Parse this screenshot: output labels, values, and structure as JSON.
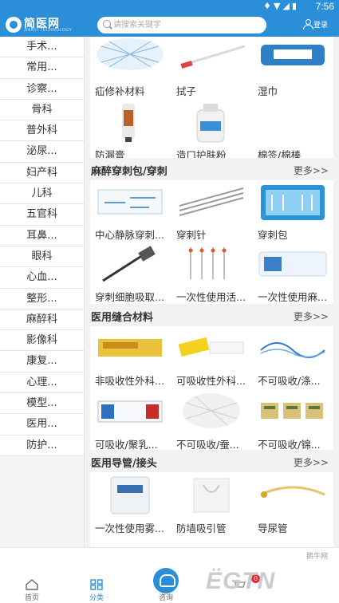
{
  "status": {
    "time": "7:56"
  },
  "header": {
    "logo_name": "简医网",
    "logo_sub": "JIANYI TECHNOLOGY",
    "search_placeholder": "请搜索关键字",
    "login_label": "登录"
  },
  "sidebar": {
    "items": [
      "手术...",
      "常用...",
      "诊察...",
      "骨科",
      "普外科",
      "泌尿...",
      "妇产科",
      "儿科",
      "五官科",
      "耳鼻...",
      "眼科",
      "心血...",
      "整形...",
      "麻醉科",
      "影像科",
      "康复...",
      "心理...",
      "模型...",
      "医用...",
      "防护..."
    ]
  },
  "sections": [
    {
      "title": "",
      "more": "",
      "products": [
        "疝修补材料",
        "拭子",
        "湿巾",
        "防漏膏",
        "造口护肤粉",
        "棉签/棉棒"
      ]
    },
    {
      "title": "麻醉穿刺包/穿刺",
      "more": "更多>>",
      "products": [
        "中心静脉穿刺...",
        "穿刺针",
        "穿刺包",
        "穿刺细胞吸取...",
        "一次性使用活...",
        "一次性使用麻..."
      ]
    },
    {
      "title": "医用缝合材料",
      "more": "更多>>",
      "products": [
        "非吸收性外科...",
        "可吸收性外科...",
        "不可吸收/涤...",
        "可吸收/聚乳...",
        "不可吸收/蚕...",
        "不可吸收/锦..."
      ]
    },
    {
      "title": "医用导管/接头",
      "more": "更多>>",
      "products": [
        "一次性使用雾...",
        "防墙吸引管",
        "导尿管"
      ]
    }
  ],
  "footer": {
    "tabs": [
      "首页",
      "分类",
      "咨询",
      "",
      ""
    ],
    "badge": "0",
    "watermark": "ЁGTN",
    "watermark_small": "鹅牛网"
  },
  "colors": {
    "brand": "#2a8fd8",
    "badge": "#ee2233"
  }
}
